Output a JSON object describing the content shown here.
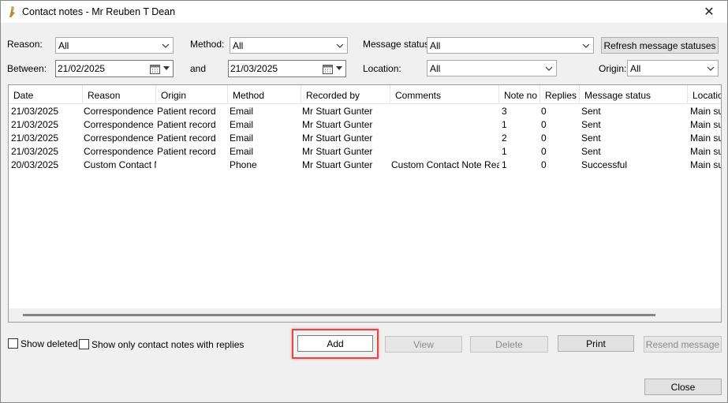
{
  "window": {
    "title": "Contact notes - Mr Reuben T Dean",
    "close_glyph": "✕"
  },
  "filters": {
    "reason": {
      "label": "Reason:",
      "value": "All"
    },
    "method": {
      "label": "Method:",
      "value": "All"
    },
    "message_status": {
      "label": "Message status:",
      "value": "All"
    },
    "refresh_label": "Refresh message statuses",
    "between": {
      "label": "Between:",
      "value": "21/02/2025"
    },
    "and": {
      "label": "and",
      "value": "21/03/2025"
    },
    "location": {
      "label": "Location:",
      "value": "All"
    },
    "origin": {
      "label": "Origin:",
      "value": "All"
    }
  },
  "table": {
    "columns": [
      "Date",
      "Reason",
      "Origin",
      "Method",
      "Recorded by",
      "Comments",
      "Note no",
      "Replies",
      "Message status",
      "Locatio"
    ],
    "rows": [
      [
        "21/03/2025",
        "Correspondence In",
        "Patient record",
        "Email",
        "Mr Stuart Gunter",
        "",
        "3",
        "0",
        "Sent",
        "Main sur"
      ],
      [
        "21/03/2025",
        "Correspondence In",
        "Patient record",
        "Email",
        "Mr Stuart Gunter",
        "",
        "1",
        "0",
        "Sent",
        "Main sur"
      ],
      [
        "21/03/2025",
        "Correspondence In",
        "Patient record",
        "Email",
        "Mr Stuart Gunter",
        "",
        "2",
        "0",
        "Sent",
        "Main sur"
      ],
      [
        "21/03/2025",
        "Correspondence In",
        "Patient record",
        "Email",
        "Mr Stuart Gunter",
        "",
        "1",
        "0",
        "Sent",
        "Main sur"
      ],
      [
        "20/03/2025",
        "Custom Contact No",
        "",
        "Phone",
        "Mr Stuart Gunter",
        "Custom Contact Note Reasor",
        "1",
        "0",
        "Successful",
        "Main sur"
      ]
    ]
  },
  "options": {
    "show_deleted": "Show deleted",
    "show_replies": "Show only contact notes with replies"
  },
  "buttons": {
    "add": "Add",
    "view": "View",
    "delete": "Delete",
    "print": "Print",
    "resend": "Resend message",
    "close": "Close"
  },
  "colors": {
    "highlight": "#e04848",
    "window_bg": "#f0f0f0"
  }
}
